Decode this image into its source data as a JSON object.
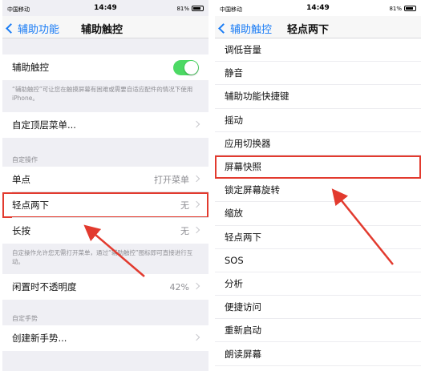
{
  "left": {
    "status": {
      "carrier": "中国移动",
      "time": "14:49",
      "battery": "81%"
    },
    "nav": {
      "back": "辅助功能",
      "title": "辅助触控"
    },
    "toggle_row": {
      "label": "辅助触控"
    },
    "toggle_note": "“辅助触控”可让您在触摸屏幕有困难或需要自适应配件的情况下使用 iPhone。",
    "custom_menu": {
      "label": "自定顶层菜单..."
    },
    "custom_actions_header": "自定操作",
    "actions": [
      {
        "label": "单点",
        "value": "打开菜单"
      },
      {
        "label": "轻点两下",
        "value": "无"
      },
      {
        "label": "长按",
        "value": "无"
      }
    ],
    "actions_note": "自定操作允许您无需打开菜单，通过“辅助触控”图标即可直接进行互动。",
    "idle_opacity": {
      "label": "闲置时不透明度",
      "value": "42%"
    },
    "custom_gestures_header": "自定手势",
    "create_gesture": {
      "label": "创建新手势..."
    }
  },
  "right": {
    "status": {
      "carrier": "中国移动",
      "time": "14:49",
      "battery": "81%"
    },
    "nav": {
      "back": "辅助触控",
      "title": "轻点两下"
    },
    "items": [
      "调低音量",
      "静音",
      "辅助功能快捷键",
      "摇动",
      "应用切换器",
      "屏幕快照",
      "锁定屏幕旋转",
      "缩放",
      "轻点两下",
      "SOS",
      "分析",
      "便捷访问",
      "重新启动",
      "朗读屏幕"
    ]
  },
  "colors": {
    "accent": "#1a7cf5",
    "toggle_on": "#4cd964",
    "highlight": "#e23a2e"
  }
}
